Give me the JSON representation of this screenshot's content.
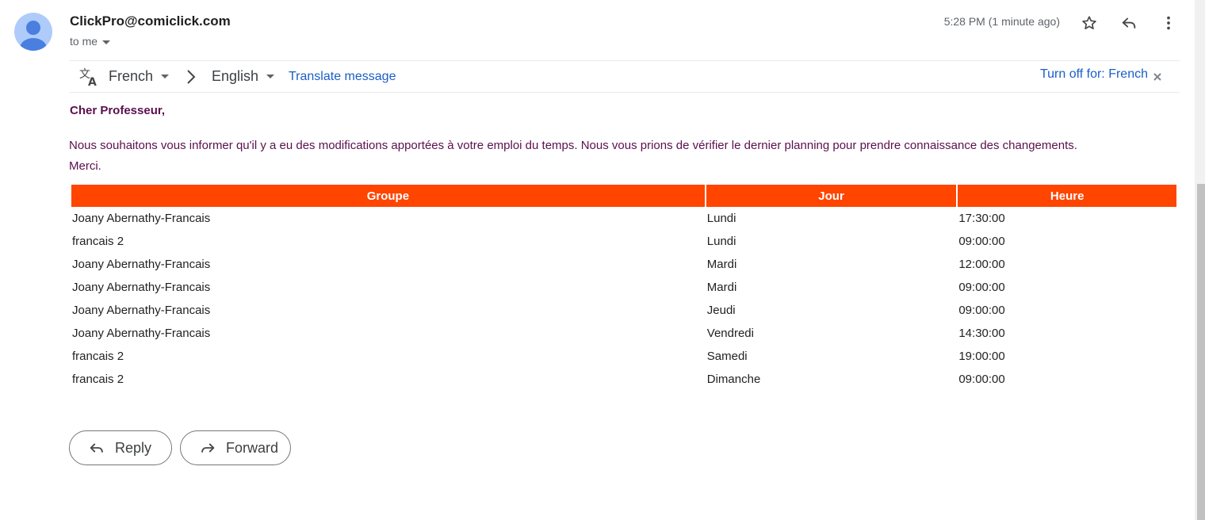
{
  "email": {
    "sender": "ClickPro@comiclick.com",
    "recipient_label": "to me",
    "timestamp": "5:28 PM (1 minute ago)"
  },
  "translation": {
    "from_lang": "French",
    "to_lang": "English",
    "translate_link": "Translate message",
    "turn_off_link": "Turn off for: French"
  },
  "message": {
    "greeting": "Cher Professeur,",
    "paragraph": "Nous souhaitons vous informer qu'il y a eu des modifications apportées à votre emploi du temps. Nous vous prions de vérifier le dernier planning pour prendre connaissance des changements.",
    "closing": "Merci."
  },
  "schedule": {
    "headers": [
      "Groupe",
      "Jour",
      "Heure"
    ],
    "rows": [
      [
        "Joany Abernathy-Francais",
        "Lundi",
        "17:30:00"
      ],
      [
        "francais 2",
        "Lundi",
        "09:00:00"
      ],
      [
        "Joany Abernathy-Francais",
        "Mardi",
        "12:00:00"
      ],
      [
        "Joany Abernathy-Francais",
        "Mardi",
        "09:00:00"
      ],
      [
        "Joany Abernathy-Francais",
        "Jeudi",
        "09:00:00"
      ],
      [
        "Joany Abernathy-Francais",
        "Vendredi",
        "14:30:00"
      ],
      [
        "francais 2",
        "Samedi",
        "19:00:00"
      ],
      [
        "francais 2",
        "Dimanche",
        "09:00:00"
      ]
    ]
  },
  "actions": {
    "reply_label": "Reply",
    "forward_label": "Forward"
  },
  "icons": {
    "avatar": "person-icon",
    "star": "star-icon",
    "reply": "reply-icon",
    "more": "more-vert-icon",
    "translate": "translate-icon",
    "chevron": "chevron-right-icon",
    "close": "close-icon",
    "forward": "forward-icon"
  },
  "colors": {
    "table_header_bg": "#ff4500",
    "message_text": "#5b0f4e",
    "link": "#1a5ec7",
    "avatar_bg": "#aecbfa",
    "avatar_fg": "#4a7fe0"
  }
}
